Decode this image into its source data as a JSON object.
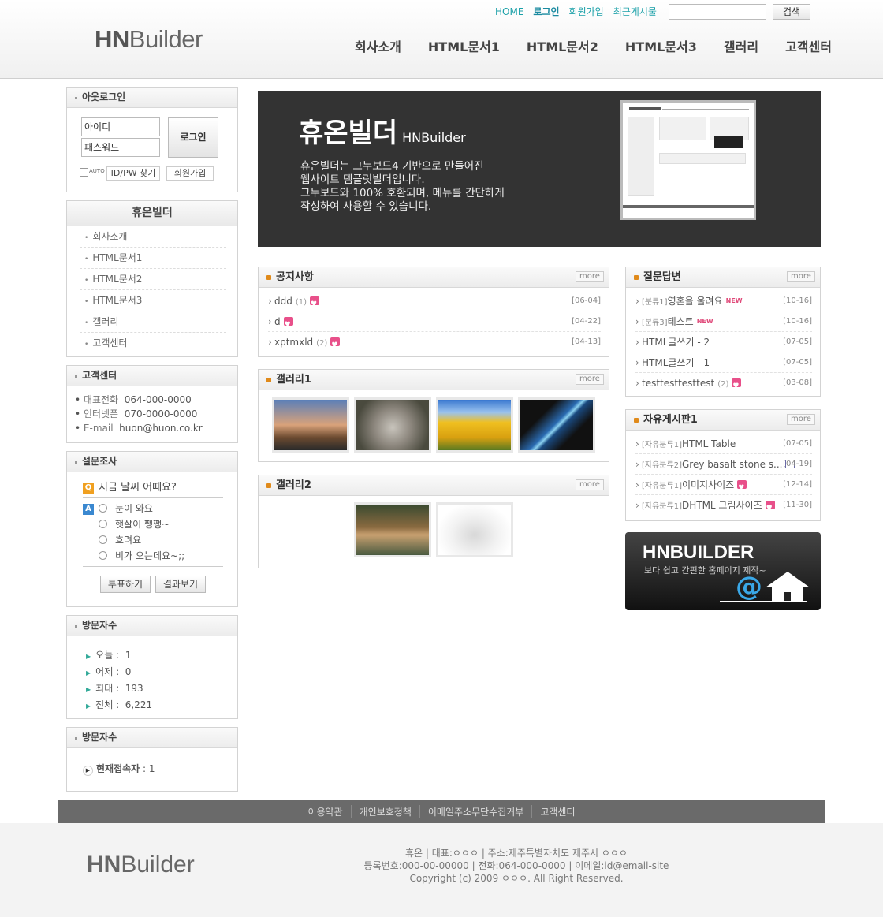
{
  "header": {
    "logo_main": "HN",
    "logo_sub": "Builder",
    "topnav": [
      "HOME",
      "로그인",
      "회원가입",
      "최근게시물"
    ],
    "search_button": "검색",
    "gnb": [
      "회사소개",
      "HTML문서1",
      "HTML문서2",
      "HTML문서3",
      "갤러리",
      "고객센터"
    ]
  },
  "login": {
    "title": "아웃로그인",
    "id_placeholder": "아이디",
    "pw_placeholder": "패스워드",
    "login_button": "로그인",
    "auto_label": "AUTO",
    "find_button": "ID/PW 찾기",
    "join_button": "회원가입"
  },
  "company_menu": {
    "title": "휴온빌더",
    "items": [
      "회사소개",
      "HTML문서1",
      "HTML문서2",
      "HTML문서3",
      "갤러리",
      "고객센터"
    ]
  },
  "customer_center": {
    "title": "고객센터",
    "rows": [
      {
        "label": "대표전화",
        "value": "064-000-0000"
      },
      {
        "label": "인터넷폰",
        "value": "070-0000-0000"
      },
      {
        "label": "E-mail",
        "value": "huon@huon.co.kr"
      }
    ]
  },
  "poll": {
    "title": "설문조사",
    "q_badge": "Q",
    "a_badge": "A",
    "question": "지금 날씨 어때요?",
    "options": [
      "눈이 와요",
      "햇살이 쨍쨍~",
      "흐려요",
      "비가 오는데요~;;"
    ],
    "vote_button": "투표하기",
    "result_button": "결과보기",
    "colors": {
      "q": "#f0a020",
      "a": "#3a88d0"
    }
  },
  "visitors": {
    "title": "방문자수",
    "rows": [
      {
        "label": "오늘",
        "value": "1"
      },
      {
        "label": "어제",
        "value": "0"
      },
      {
        "label": "최대",
        "value": "193"
      },
      {
        "label": "전체",
        "value": "6,221"
      }
    ]
  },
  "connected": {
    "title": "방문자수",
    "label": "현재접속자",
    "value": "1"
  },
  "banner": {
    "title": "휴온빌더",
    "title_en": "HNBuilder",
    "lines": [
      "휴온빌더는 그누보드4 기반으로 만들어진",
      "웹사이트 템플릿빌더입니다.",
      "그누보드와 100% 호환되며, 메뉴를 간단하게",
      "작성하여 사용할 수 있습니다."
    ]
  },
  "more_label": "more",
  "notice": {
    "title": "공지사항",
    "items": [
      {
        "title": "ddd",
        "count": "(1)",
        "date": "[06-04]"
      },
      {
        "title": "d",
        "count": "",
        "date": "[04-22]"
      },
      {
        "title": "xptmxld",
        "count": "(2)",
        "date": "[04-13]"
      }
    ]
  },
  "gallery1": {
    "title": "갤러리1"
  },
  "gallery2": {
    "title": "갤러리2"
  },
  "qna": {
    "title": "질문답변",
    "items": [
      {
        "cat": "[분류1]",
        "title": "영혼을 울려요",
        "new": "NEW",
        "date": "[10-16]"
      },
      {
        "cat": "[분류3]",
        "title": "테스트",
        "new": "NEW",
        "date": "[10-16]"
      },
      {
        "cat": "",
        "title": "HTML글쓰기 - 2",
        "new": "",
        "date": "[07-05]"
      },
      {
        "cat": "",
        "title": "HTML글쓰기 - 1",
        "new": "",
        "date": "[07-05]"
      },
      {
        "cat": "",
        "title": "testtesttesttest",
        "count": "(2)",
        "new": "",
        "date": "[03-08]"
      }
    ]
  },
  "free": {
    "title": "자유게시판1",
    "items": [
      {
        "cat": "[자유분류1]",
        "title": "HTML Table",
        "date": "[07-05]"
      },
      {
        "cat": "[자유분류2]",
        "title": "Grey basalt stone s...",
        "date": "[04-19]"
      },
      {
        "cat": "[자유분류1]",
        "title": "이미지사이즈",
        "date": "[12-14]"
      },
      {
        "cat": "[자유분류1]",
        "title": "DHTML 그림사이즈",
        "date": "[11-30]"
      }
    ]
  },
  "hnb_banner": {
    "title": "HNBUILDER",
    "sub": "보다 쉽고 간편한 홈페이지 제작~"
  },
  "footer": {
    "links": [
      "이용약관",
      "개인보호정책",
      "이메일주소무단수집거부",
      "고객센터"
    ],
    "logo_main": "HN",
    "logo_sub": "Builder",
    "info": [
      "휴온 | 대표:ㅇㅇㅇ | 주소:제주특별자치도 제주시 ㅇㅇㅇ",
      "등록번호:000-00-00000 | 전화:064-000-0000 | 이메일:id@email-site",
      "Copyright (c) 2009 ㅇㅇㅇ. All Right Reserved."
    ]
  }
}
